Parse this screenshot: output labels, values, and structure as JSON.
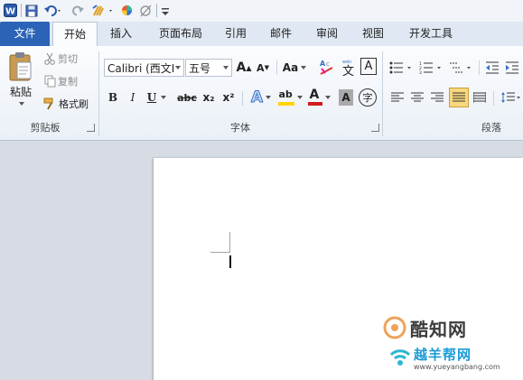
{
  "qat": {
    "word_icon": "word-logo-icon",
    "save_icon": "save-icon",
    "undo_icon": "undo-icon",
    "redo_icon": "redo-icon",
    "format_painter_icon": "brush-icon",
    "color_icon": "color-wheel-icon",
    "clear_icon": "clear-format-icon",
    "customize_icon": "customize-icon"
  },
  "tabs": [
    {
      "label": "文件"
    },
    {
      "label": "开始"
    },
    {
      "label": "插入"
    },
    {
      "label": "页面布局"
    },
    {
      "label": "引用"
    },
    {
      "label": "邮件"
    },
    {
      "label": "审阅"
    },
    {
      "label": "视图"
    },
    {
      "label": "开发工具"
    }
  ],
  "clipboard": {
    "paste_label": "粘贴",
    "cut_label": "剪切",
    "copy_label": "复制",
    "format_painter_label": "格式刷",
    "group_label": "剪贴板"
  },
  "font": {
    "font_name": "Calibri (西文I",
    "font_size": "五号",
    "grow_label": "A",
    "shrink_label": "A",
    "case_label": "Aa",
    "bold": "B",
    "italic": "I",
    "underline": "U",
    "strike": "abc",
    "subscript": "x₂",
    "superscript": "x²",
    "effects": "A",
    "highlight": "ab",
    "font_color": "A",
    "shade": "A",
    "enclose": "字",
    "pinyin": "文",
    "border": "A",
    "group_label": "字体"
  },
  "paragraph": {
    "group_label": "段落"
  },
  "colors": {
    "file_tab": "#2b63b6",
    "accent_blue": "#3a6fc4",
    "highlight_yellow": "#ffd400",
    "font_red": "#d01c1c",
    "active_button": "#f9d77e"
  },
  "watermark": {
    "brand1": "酷知网",
    "brand2": "越羊帮网",
    "url": "www.yueyangbang.com"
  }
}
